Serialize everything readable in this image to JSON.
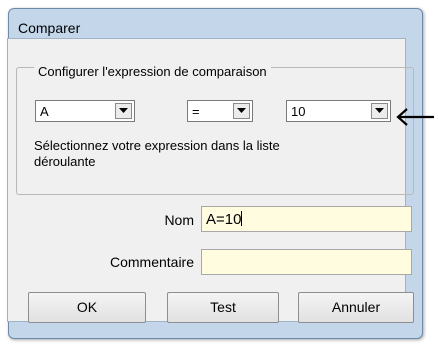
{
  "dialog": {
    "title": "Comparer"
  },
  "expression_group": {
    "legend": "Configurer l'expression de comparaison",
    "left_operand": "A",
    "operator": "=",
    "right_operand": "10",
    "hint": "Sélectionnez votre expression dans la liste déroulante"
  },
  "form": {
    "name_label": "Nom",
    "name_value": "A=10",
    "comment_label": "Commentaire",
    "comment_value": ""
  },
  "buttons": {
    "ok": "OK",
    "test": "Test",
    "cancel": "Annuler"
  },
  "icons": {
    "dropdown": "chevron-down-icon",
    "callout": "arrow-left-icon"
  },
  "colors": {
    "window_frame": "#c4d6ea",
    "client_bg": "#f0f0f0",
    "field_bg": "#fffce0"
  }
}
